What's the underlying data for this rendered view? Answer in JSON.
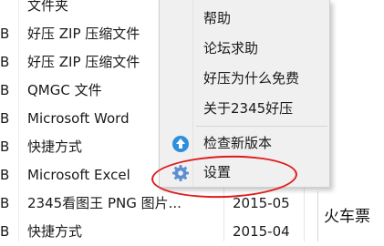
{
  "file_list": {
    "rows": [
      {
        "size_tail": "",
        "type": "文件夹",
        "date": ""
      },
      {
        "size_tail": "B",
        "type": "好压 ZIP 压缩文件",
        "date": ""
      },
      {
        "size_tail": "B",
        "type": "好压 ZIP 压缩文件",
        "date": ""
      },
      {
        "size_tail": "B",
        "type": "QMGC 文件",
        "date": ""
      },
      {
        "size_tail": "B",
        "type": "Microsoft Word",
        "date": ""
      },
      {
        "size_tail": "B",
        "type": "快捷方式",
        "date": ""
      },
      {
        "size_tail": "B",
        "type": "Microsoft Excel",
        "date": ""
      },
      {
        "size_tail": "B",
        "type": "2345看图王 PNG 图片...",
        "date": "2015-05"
      },
      {
        "size_tail": "B",
        "type": "快捷方式",
        "date": "2015-04"
      }
    ]
  },
  "context_menu": {
    "items": [
      {
        "label": "帮助"
      },
      {
        "label": "论坛求助"
      },
      {
        "label": "好压为什么免费"
      },
      {
        "label": "关于2345好压"
      },
      {
        "label": "检查新版本",
        "icon": "update-arrow-icon"
      },
      {
        "label": "设置",
        "icon": "gear-icon"
      }
    ]
  },
  "partial_window": {
    "text": "火车票"
  },
  "colors": {
    "annotation_red": "#e01b1b",
    "update_icon_blue": "#2e8fdc",
    "gear_icon_blue": "#5b8fd0",
    "menu_background": "#f0f0f0"
  }
}
